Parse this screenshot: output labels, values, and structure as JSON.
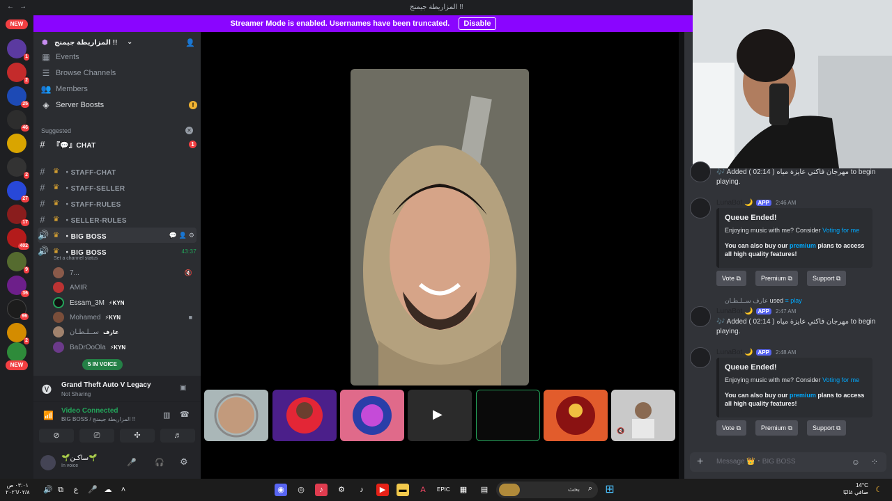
{
  "titlebar": {
    "back_glyph": "←",
    "forward_glyph": "→",
    "title": "المزاريطة جيمنج !!"
  },
  "banner": {
    "text": "Streamer Mode is enabled. Usernames have been truncated.",
    "disable_label": "Disable",
    "color": "#8a05ff"
  },
  "servers": {
    "new_label": "NEW",
    "badges": [
      "1",
      "2",
      "25",
      "46",
      "2",
      "27",
      "17",
      "402",
      "9",
      "36",
      "96",
      "2"
    ]
  },
  "sidebar": {
    "server_name": "المزاريطة جيمنج !!",
    "nav_items": [
      {
        "label": "Events",
        "icon": "calendar-icon"
      },
      {
        "label": "Browse Channels",
        "icon": "list-icon"
      },
      {
        "label": "Members",
        "icon": "members-icon"
      },
      {
        "label": "Server Boosts",
        "icon": "boost-icon",
        "alert": "!"
      }
    ],
    "suggested_label": "Suggested",
    "suggested_channel": "『💬』CHAT",
    "suggested_badge": "1",
    "channels": [
      {
        "label": "・STAFF-CHAT"
      },
      {
        "label": "・STAFF-SELLER"
      },
      {
        "label": "・STAFF-RULES"
      },
      {
        "label": "・SELLER-RULES"
      },
      {
        "label": "・BIG BOSS"
      }
    ],
    "voice_channel": {
      "label": "・BIG BOSS",
      "timer": "43:37",
      "status": "Set a channel status"
    },
    "members": [
      {
        "name": "7...",
        "tag": ""
      },
      {
        "name": "AMIR",
        "tag": ""
      },
      {
        "name": "Essam_3M",
        "tag": "⚡KYN"
      },
      {
        "name": "Mohamed",
        "tag": "⚡KYN"
      },
      {
        "name": "ســلـطـان",
        "tag": "عارف"
      },
      {
        "name": "BaDrOoOla",
        "tag": "⚡KYN"
      }
    ],
    "in_voice_pill": "5 IN VOICE"
  },
  "panel": {
    "game_title": "Grand Theft Auto V Legacy",
    "game_sub": "Not Sharing",
    "video_connected": "Video Connected",
    "voice_path": "BIG BOSS / المزاريطة جيمنج !!",
    "user_name": "🌱ساكـن🌱",
    "user_status": "In voice"
  },
  "chat": {
    "msg1_text": "🎶 Added ( 02:14 ) مهرجان فاكتي عايزة مياه to begin playing.",
    "bot_name": "LunaBot 🌙",
    "app_label": "APP",
    "time_1": "2:46 AM",
    "time_2": "2:47 AM",
    "time_3": "2:48 AM",
    "embed_title": "Queue Ended!",
    "embed_line1_pre": "Enjoying music with me? Consider ",
    "embed_line1_link": "Voting for me",
    "embed_line2_pre": "You can also buy our ",
    "embed_line2_link": "premium",
    "embed_line2_post": " plans to access all high quality features!",
    "vote_label": "Vote",
    "premium_label": "Premium",
    "support_label": "Support",
    "used_user": "عارف ســلـطـان",
    "used_word": "used",
    "used_cmd": "⌗ play",
    "input_placeholder": "Message 👑・BIG BOSS"
  },
  "taskbar": {
    "clock_time": "٠٣:٠١ ص",
    "clock_date": "٢٠٢٦/٠٢/٨",
    "lang": "ع",
    "search_placeholder": "بحث",
    "weather_temp": "14°C",
    "weather_desc": "صافي غالبًا"
  }
}
